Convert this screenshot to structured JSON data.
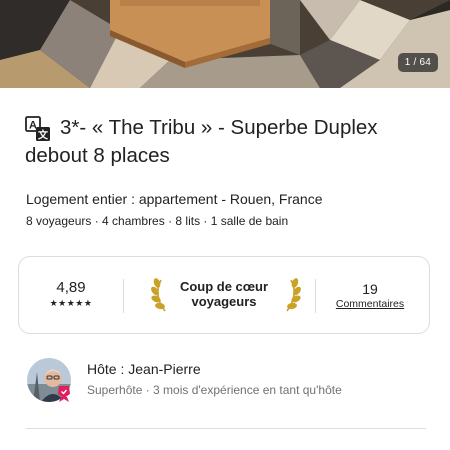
{
  "photo": {
    "counter": "1 / 64"
  },
  "listing": {
    "translate_icon": "translate-icon",
    "title": "3*- « The Tribu » - Superbe Duplex debout 8 places",
    "subtitle": "Logement entier : appartement - Rouen, France",
    "details": "8 voyageurs · 4 chambres · 8 lits · 1 salle de bain"
  },
  "highlights": {
    "rating": "4,89",
    "stars": "★★★★★",
    "star_count": 5,
    "guest_favorite_line1": "Coup de cœur",
    "guest_favorite_line2": "voyageurs",
    "reviews_count": "19",
    "reviews_label": "Commentaires"
  },
  "host": {
    "name": "Hôte : Jean-Pierre",
    "meta": "Superhôte · 3 mois d'expérience en tant qu'hôte",
    "badge_icon": "superhost-badge-icon"
  },
  "colors": {
    "text": "#222222",
    "muted": "#717171",
    "border": "#dddddd",
    "laurel": "#c9a227",
    "superhost": "#e31c5f"
  }
}
